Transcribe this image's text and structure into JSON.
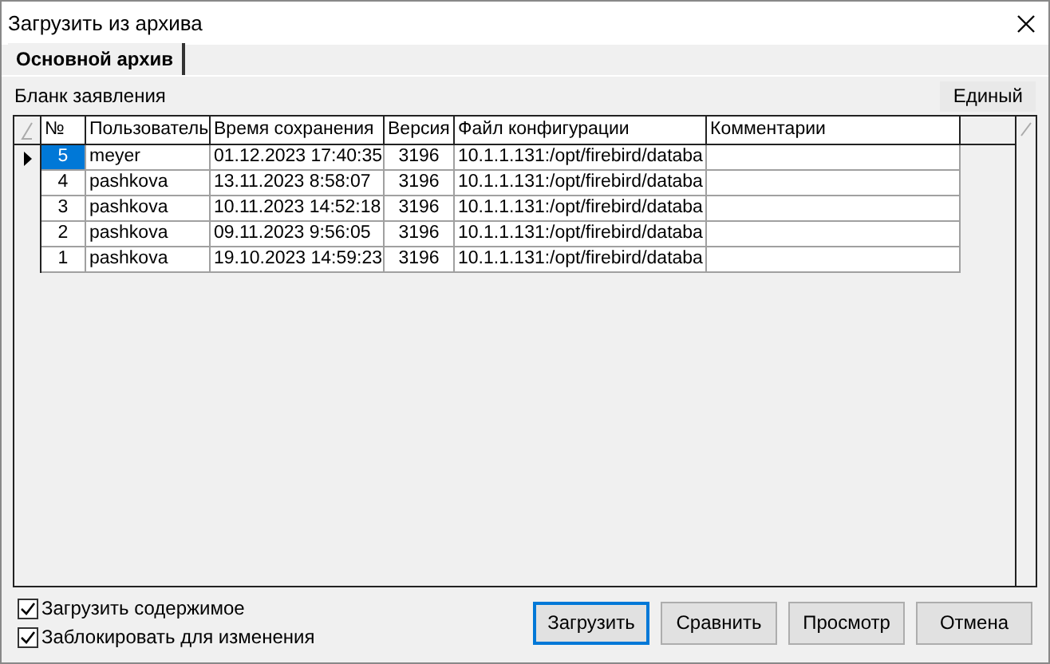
{
  "window": {
    "title": "Загрузить из архива"
  },
  "tabs": [
    {
      "label": "Основной архив",
      "selected": true
    }
  ],
  "form_label": "Бланк заявления",
  "mode_button": "Единый",
  "table": {
    "columns": [
      "№",
      "Пользователь",
      "Время сохранения",
      "Версия",
      "Файл конфигурации",
      "Комментарии"
    ],
    "rows": [
      {
        "selected": true,
        "cells": [
          "5",
          "meyer",
          "01.12.2023 17:40:35",
          "3196",
          "10.1.1.131:/opt/firebird/databa",
          ""
        ]
      },
      {
        "selected": false,
        "cells": [
          "4",
          "pashkova",
          "13.11.2023 8:58:07",
          "3196",
          "10.1.1.131:/opt/firebird/databa",
          ""
        ]
      },
      {
        "selected": false,
        "cells": [
          "3",
          "pashkova",
          "10.11.2023 14:52:18",
          "3196",
          "10.1.1.131:/opt/firebird/databa",
          ""
        ]
      },
      {
        "selected": false,
        "cells": [
          "2",
          "pashkova",
          "09.11.2023 9:56:05",
          "3196",
          "10.1.1.131:/opt/firebird/databa",
          ""
        ]
      },
      {
        "selected": false,
        "cells": [
          "1",
          "pashkova",
          "19.10.2023 14:59:23",
          "3196",
          "10.1.1.131:/opt/firebird/databa",
          ""
        ]
      }
    ]
  },
  "options": [
    {
      "label": "Загрузить содержимое",
      "checked": true
    },
    {
      "label": "Заблокировать для изменения",
      "checked": true
    }
  ],
  "buttons": [
    {
      "label": "Загрузить",
      "default": true
    },
    {
      "label": "Сравнить",
      "default": false
    },
    {
      "label": "Просмотр",
      "default": false
    },
    {
      "label": "Отмена",
      "default": false
    }
  ]
}
